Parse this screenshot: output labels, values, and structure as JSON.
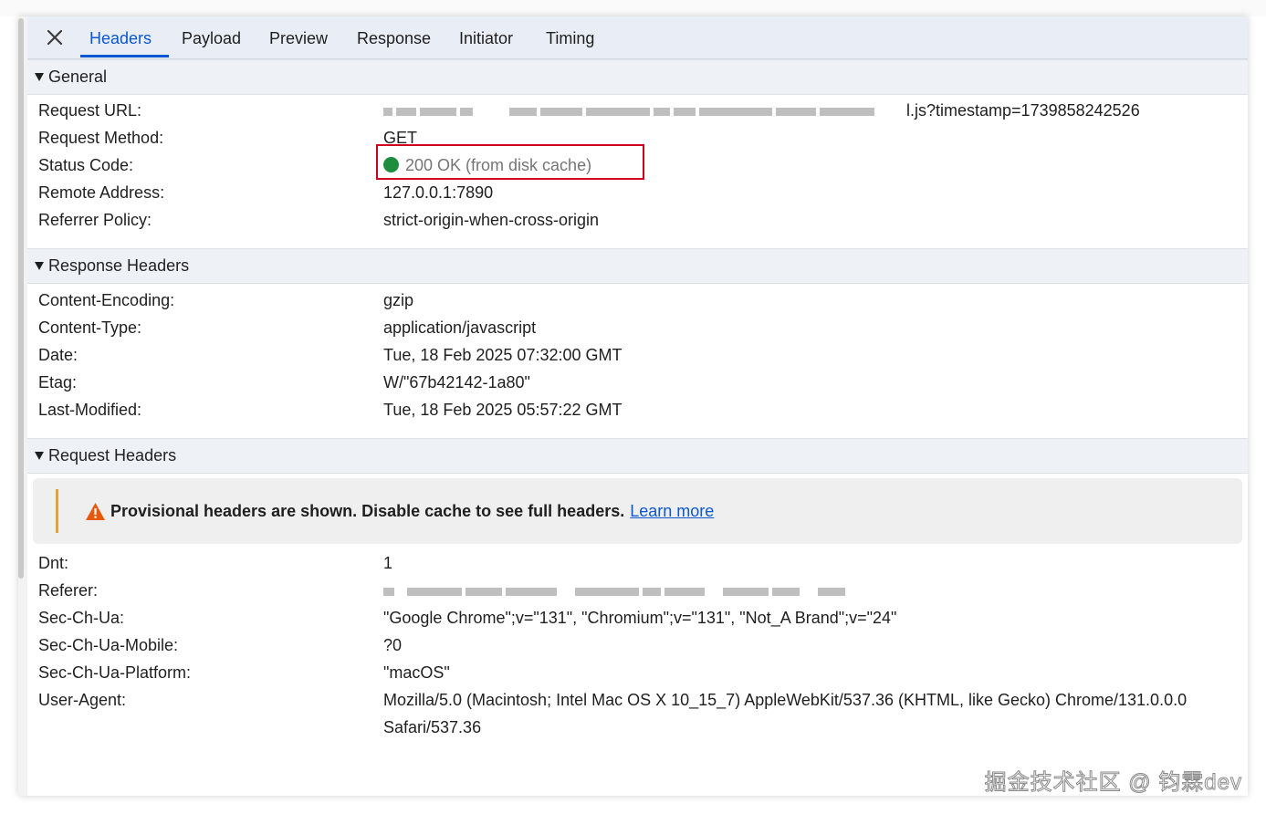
{
  "tabs": {
    "close_label": "✕",
    "items": [
      {
        "label": "Headers",
        "active": true
      },
      {
        "label": "Payload",
        "active": false
      },
      {
        "label": "Preview",
        "active": false
      },
      {
        "label": "Response",
        "active": false
      },
      {
        "label": "Initiator",
        "active": false
      },
      {
        "label": "Timing",
        "active": false
      }
    ]
  },
  "general": {
    "title": "General",
    "rows": [
      {
        "key": "Request URL:",
        "value": "l.js?timestamp=1739858242526"
      },
      {
        "key": "Request Method:",
        "value": "GET"
      },
      {
        "key": "Status Code:",
        "value": "200 OK (from disk cache)"
      },
      {
        "key": "Remote Address:",
        "value": "127.0.0.1:7890"
      },
      {
        "key": "Referrer Policy:",
        "value": "strict-origin-when-cross-origin"
      }
    ]
  },
  "response_headers": {
    "title": "Response Headers",
    "rows": [
      {
        "key": "Content-Encoding:",
        "value": "gzip"
      },
      {
        "key": "Content-Type:",
        "value": "application/javascript"
      },
      {
        "key": "Date:",
        "value": "Tue, 18 Feb 2025 07:32:00 GMT"
      },
      {
        "key": "Etag:",
        "value": "W/\"67b42142-1a80\""
      },
      {
        "key": "Last-Modified:",
        "value": "Tue, 18 Feb 2025 05:57:22 GMT"
      }
    ]
  },
  "request_headers": {
    "title": "Request Headers",
    "warning": {
      "text": "Provisional headers are shown. Disable cache to see full headers.",
      "link": "Learn more"
    },
    "rows": [
      {
        "key": "Dnt:",
        "value": "1"
      },
      {
        "key": "Referer:",
        "value": ""
      },
      {
        "key": "Sec-Ch-Ua:",
        "value": "\"Google Chrome\";v=\"131\", \"Chromium\";v=\"131\", \"Not_A Brand\";v=\"24\""
      },
      {
        "key": "Sec-Ch-Ua-Mobile:",
        "value": "?0"
      },
      {
        "key": "Sec-Ch-Ua-Platform:",
        "value": "\"macOS\""
      },
      {
        "key": "User-Agent:",
        "value": "Mozilla/5.0 (Macintosh; Intel Mac OS X 10_15_7) AppleWebKit/537.36 (KHTML, like Gecko) Chrome/131.0.0.0",
        "value_line2": "Safari/537.36"
      }
    ]
  },
  "watermark": "掘金技术社区 @ 钧霖dev",
  "colors": {
    "accent": "#0b57d0",
    "status_ok": "#1e8e3e",
    "highlight_box": "#d0021b",
    "warning": "#e8a13a"
  }
}
